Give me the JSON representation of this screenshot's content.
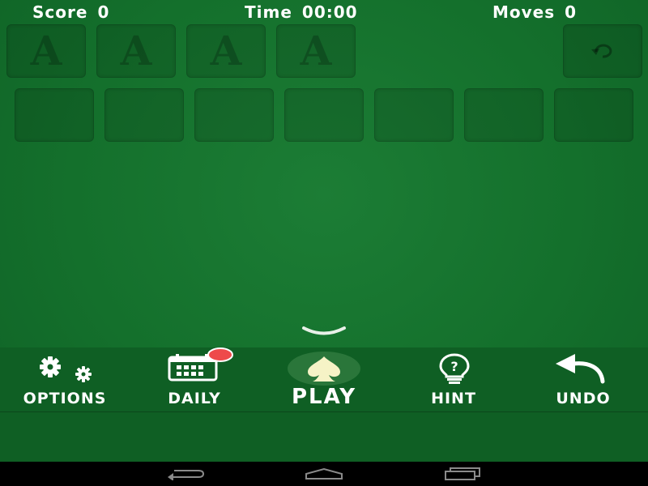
{
  "stats": {
    "score_label": "Score",
    "score_value": "0",
    "time_label": "Time",
    "time_value": "00:00",
    "moves_label": "Moves",
    "moves_value": "0"
  },
  "foundations": [
    "A",
    "A",
    "A",
    "A"
  ],
  "bottom_nav": {
    "options": "OPTIONS",
    "daily": "DAILY",
    "play": "PLAY",
    "hint": "HINT",
    "undo": "UNDO"
  },
  "colors": {
    "felt": "#14702c",
    "bar": "#0f5f24",
    "badge": "#ee4a4a",
    "spade_glow": "#f6f3c6"
  },
  "icons": {
    "options": "gears-icon",
    "daily": "calendar-icon",
    "play": "spade-icon",
    "hint": "lightbulb-icon",
    "undo": "undo-arrow-icon",
    "stock": "redeal-icon"
  }
}
